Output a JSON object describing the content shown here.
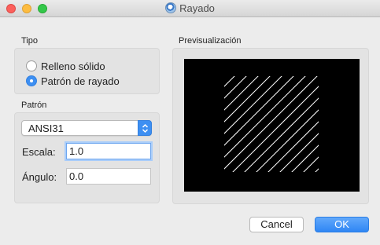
{
  "window": {
    "title": "Rayado",
    "icon": "qgis-app-icon"
  },
  "tipo": {
    "label": "Tipo",
    "options": [
      {
        "label": "Relleno sólido",
        "selected": false
      },
      {
        "label": "Patrón de rayado",
        "selected": true
      }
    ]
  },
  "patron": {
    "label": "Patrón",
    "selected": "ANSI31",
    "escala_label": "Escala:",
    "escala_value": "1.0",
    "angulo_label": "Ángulo:",
    "angulo_value": "0.0"
  },
  "preview": {
    "label": "Previsualización",
    "background": "#000000",
    "hatch_color": "#ffffff",
    "hatch_angle_deg": 45
  },
  "buttons": {
    "cancel": "Cancel",
    "ok": "OK"
  },
  "colors": {
    "accent": "#3d8ff2"
  }
}
